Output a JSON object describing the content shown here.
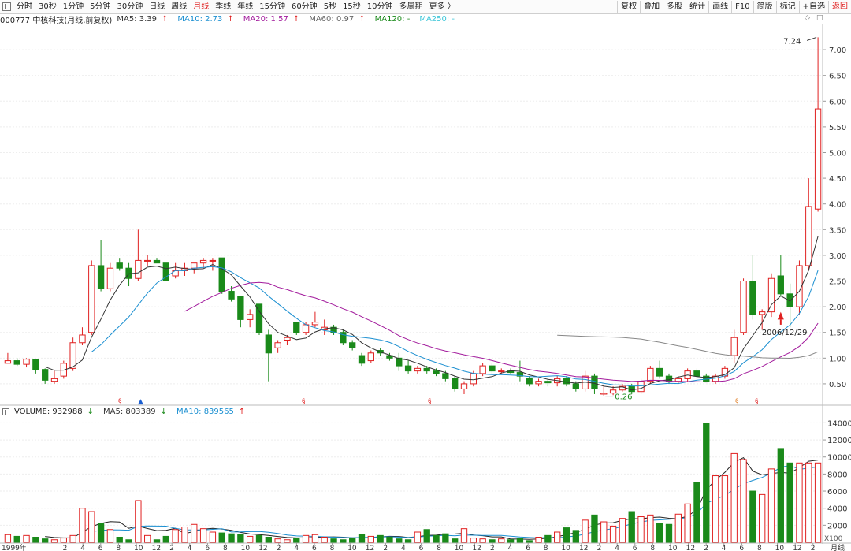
{
  "toolbar": {
    "tabs": [
      "分时",
      "30秒",
      "1分钟",
      "5分钟",
      "30分钟",
      "日线",
      "周线",
      "月线",
      "季线",
      "年线",
      "15分钟",
      "60分钟",
      "5秒",
      "15秒",
      "10分钟",
      "多周期",
      "更多 〉"
    ],
    "active_tab": "月线",
    "right_buttons": [
      "复权",
      "叠加",
      "多股",
      "统计",
      "画线",
      "F10",
      "简版",
      "标记",
      "+自选",
      "返回"
    ]
  },
  "window_controls": [
    "◇",
    "□"
  ],
  "price_panel": {
    "stock": "000777 中核科技(月线,前复权)",
    "ma_values": [
      {
        "label": "MA5: 3.39",
        "arrow": "↑",
        "color": "#333333"
      },
      {
        "label": "MA10: 2.73",
        "arrow": "↑",
        "color": "#1b8fd1"
      },
      {
        "label": "MA20: 1.57",
        "arrow": "↑",
        "color": "#a21a9c"
      },
      {
        "label": "MA60: 0.97",
        "arrow": "↑",
        "color": "#666666"
      },
      {
        "label": "MA120: -",
        "arrow": "",
        "color": "#1a8a1a"
      },
      {
        "label": "MA250: -",
        "arrow": "",
        "color": "#3cc6d8"
      }
    ],
    "high_label": "7.24",
    "low_label": "0.26",
    "annotation_date": "2006/12/29",
    "event_markers": [
      "§",
      "§",
      "§",
      "§",
      "§"
    ]
  },
  "volume_panel": {
    "title": "VOLUME: 932988",
    "title_arrow": "↓",
    "ma5": "MA5: 803389",
    "ma5_arrow": "↓",
    "ma10": "MA10: 839565",
    "ma10_arrow": "↑",
    "unit": "X100"
  },
  "x_axis": {
    "year_label": "1999年",
    "ticks": [
      "12",
      "2",
      "4",
      "6",
      "8",
      "10",
      "12",
      "2",
      "4",
      "6",
      "8",
      "10",
      "12",
      "2",
      "4",
      "6",
      "8",
      "10",
      "12",
      "2",
      "4",
      "6",
      "8",
      "10",
      "12",
      "2",
      "4",
      "6",
      "8",
      "10",
      "12",
      "2",
      "4",
      "6",
      "8",
      "10",
      "12",
      "2",
      "4",
      "6",
      "8",
      "10",
      "12",
      "2"
    ],
    "period_label": "月线"
  },
  "colors": {
    "up": "#e02020",
    "down": "#1a8a1a",
    "ma5": "#333333",
    "ma10": "#1b8fd1",
    "ma20": "#a21a9c",
    "ma60": "#888888"
  },
  "chart_data": [
    {
      "type": "candlestick",
      "title": "000777 中核科技(月线,前复权)",
      "ylim": [
        0.1,
        7.4
      ],
      "yticks": [
        "0.50",
        "1.00",
        "1.50",
        "2.00",
        "2.50",
        "3.00",
        "3.50",
        "4.00",
        "4.50",
        "5.00",
        "5.50",
        "6.00",
        "6.50",
        "7.00"
      ],
      "ytick_values": [
        0.5,
        1,
        1.5,
        2,
        2.5,
        3,
        3.5,
        4,
        4.5,
        5,
        5.5,
        6,
        6.5,
        7
      ],
      "ohlc": [
        [
          0.9,
          1.1,
          0.9,
          0.95
        ],
        [
          0.95,
          1.0,
          0.85,
          0.88
        ],
        [
          0.88,
          1.0,
          0.82,
          0.98
        ],
        [
          0.98,
          0.98,
          0.7,
          0.78
        ],
        [
          0.78,
          0.8,
          0.5,
          0.57
        ],
        [
          0.55,
          0.75,
          0.5,
          0.6
        ],
        [
          0.65,
          0.95,
          0.6,
          0.9
        ],
        [
          0.8,
          1.4,
          0.75,
          1.3
        ],
        [
          1.3,
          1.6,
          1.25,
          1.45
        ],
        [
          1.5,
          2.9,
          1.45,
          2.8
        ],
        [
          2.8,
          3.3,
          2.3,
          2.35
        ],
        [
          2.35,
          2.85,
          2.3,
          2.75
        ],
        [
          2.85,
          2.95,
          2.7,
          2.75
        ],
        [
          2.75,
          2.85,
          2.4,
          2.55
        ],
        [
          2.55,
          3.5,
          2.5,
          2.9
        ],
        [
          2.9,
          3.0,
          2.8,
          2.9
        ],
        [
          2.9,
          2.95,
          2.85,
          2.85
        ],
        [
          2.85,
          2.85,
          2.5,
          2.5
        ],
        [
          2.6,
          2.85,
          2.55,
          2.7
        ],
        [
          2.7,
          2.85,
          2.6,
          2.75
        ],
        [
          2.75,
          2.85,
          2.65,
          2.85
        ],
        [
          2.85,
          2.95,
          2.75,
          2.9
        ],
        [
          2.9,
          2.95,
          2.7,
          2.9
        ],
        [
          2.95,
          2.95,
          2.25,
          2.3
        ],
        [
          2.3,
          2.4,
          2.1,
          2.15
        ],
        [
          2.2,
          2.2,
          1.6,
          1.75
        ],
        [
          1.75,
          1.95,
          1.6,
          1.85
        ],
        [
          2.05,
          2.05,
          1.45,
          1.5
        ],
        [
          1.45,
          1.55,
          0.55,
          1.1
        ],
        [
          1.2,
          1.35,
          1.1,
          1.3
        ],
        [
          1.35,
          1.45,
          1.25,
          1.4
        ],
        [
          1.7,
          1.7,
          1.45,
          1.5
        ],
        [
          1.5,
          1.7,
          1.45,
          1.65
        ],
        [
          1.65,
          1.9,
          1.6,
          1.7
        ],
        [
          1.55,
          1.75,
          1.45,
          1.6
        ],
        [
          1.6,
          1.65,
          1.45,
          1.5
        ],
        [
          1.5,
          1.55,
          1.25,
          1.3
        ],
        [
          1.3,
          1.35,
          1.15,
          1.2
        ],
        [
          1.05,
          1.1,
          0.85,
          0.9
        ],
        [
          0.95,
          1.15,
          0.9,
          1.1
        ],
        [
          1.15,
          1.2,
          1.05,
          1.1
        ],
        [
          1.05,
          1.1,
          0.95,
          1.0
        ],
        [
          1.0,
          1.1,
          0.75,
          0.85
        ],
        [
          0.85,
          0.95,
          0.7,
          0.75
        ],
        [
          0.75,
          0.85,
          0.7,
          0.8
        ],
        [
          0.8,
          0.85,
          0.7,
          0.75
        ],
        [
          0.75,
          0.8,
          0.65,
          0.7
        ],
        [
          0.7,
          0.75,
          0.55,
          0.6
        ],
        [
          0.6,
          0.65,
          0.35,
          0.4
        ],
        [
          0.4,
          0.55,
          0.3,
          0.5
        ],
        [
          0.5,
          0.75,
          0.45,
          0.7
        ],
        [
          0.7,
          0.9,
          0.65,
          0.85
        ],
        [
          0.85,
          0.9,
          0.7,
          0.75
        ],
        [
          0.75,
          0.8,
          0.7,
          0.75
        ],
        [
          0.75,
          0.8,
          0.7,
          0.72
        ],
        [
          0.72,
          0.95,
          0.55,
          0.65
        ],
        [
          0.6,
          0.65,
          0.45,
          0.5
        ],
        [
          0.5,
          0.6,
          0.45,
          0.55
        ],
        [
          0.55,
          0.6,
          0.45,
          0.52
        ],
        [
          0.52,
          0.65,
          0.45,
          0.6
        ],
        [
          0.6,
          0.65,
          0.45,
          0.5
        ],
        [
          0.5,
          0.55,
          0.35,
          0.4
        ],
        [
          0.4,
          0.75,
          0.35,
          0.65
        ],
        [
          0.65,
          0.7,
          0.3,
          0.4
        ],
        [
          0.3,
          0.45,
          0.26,
          0.32
        ],
        [
          0.32,
          0.45,
          0.28,
          0.38
        ],
        [
          0.38,
          0.5,
          0.35,
          0.45
        ],
        [
          0.45,
          0.5,
          0.3,
          0.35
        ],
        [
          0.35,
          0.6,
          0.3,
          0.55
        ],
        [
          0.55,
          0.85,
          0.5,
          0.8
        ],
        [
          0.8,
          0.95,
          0.6,
          0.65
        ],
        [
          0.65,
          0.7,
          0.5,
          0.55
        ],
        [
          0.55,
          0.65,
          0.5,
          0.6
        ],
        [
          0.6,
          0.8,
          0.55,
          0.75
        ],
        [
          0.75,
          0.8,
          0.6,
          0.65
        ],
        [
          0.65,
          0.7,
          0.55,
          0.55
        ],
        [
          0.55,
          0.7,
          0.5,
          0.65
        ],
        [
          0.65,
          0.85,
          0.6,
          0.8
        ],
        [
          1.05,
          1.55,
          0.9,
          1.4
        ],
        [
          1.5,
          2.55,
          1.45,
          2.5
        ],
        [
          2.5,
          3.0,
          1.75,
          1.85
        ],
        [
          1.85,
          1.95,
          1.55,
          1.9
        ],
        [
          1.9,
          2.65,
          1.8,
          2.55
        ],
        [
          2.6,
          3.0,
          2.2,
          2.25
        ],
        [
          2.25,
          2.45,
          1.6,
          2.0
        ],
        [
          2.0,
          2.9,
          1.85,
          2.8
        ],
        [
          2.8,
          4.5,
          2.7,
          3.95
        ],
        [
          3.9,
          7.24,
          3.85,
          5.85
        ]
      ],
      "volume": [
        900,
        700,
        800,
        600,
        400,
        300,
        500,
        800,
        4000,
        3600,
        2200,
        1500,
        600,
        300,
        4900,
        800,
        300,
        700,
        1500,
        1800,
        2100,
        1600,
        1200,
        1100,
        1000,
        900,
        700,
        800,
        600,
        400,
        300,
        500,
        800,
        900,
        600,
        400,
        300,
        500,
        900,
        700,
        800,
        600,
        400,
        300,
        1200,
        1500,
        800,
        1000,
        400,
        1600,
        500,
        400,
        300,
        400,
        300,
        500,
        200,
        600,
        800,
        1200,
        1700,
        1400,
        2600,
        3200,
        2400,
        1900,
        2800,
        3600,
        3000,
        3200,
        2200,
        2100,
        3300,
        4500,
        7000,
        13900,
        7800,
        7800,
        10400,
        9700,
        6000,
        5600,
        8600,
        11000,
        9300,
        9300,
        9300,
        9300
      ],
      "vol_ylim": [
        0,
        14500
      ],
      "vol_yticks": [
        "2000",
        "4000",
        "6000",
        "8000",
        "10000",
        "12000",
        "14000"
      ],
      "vol_ytick_values": [
        2000,
        4000,
        6000,
        8000,
        10000,
        12000,
        14000
      ]
    }
  ]
}
